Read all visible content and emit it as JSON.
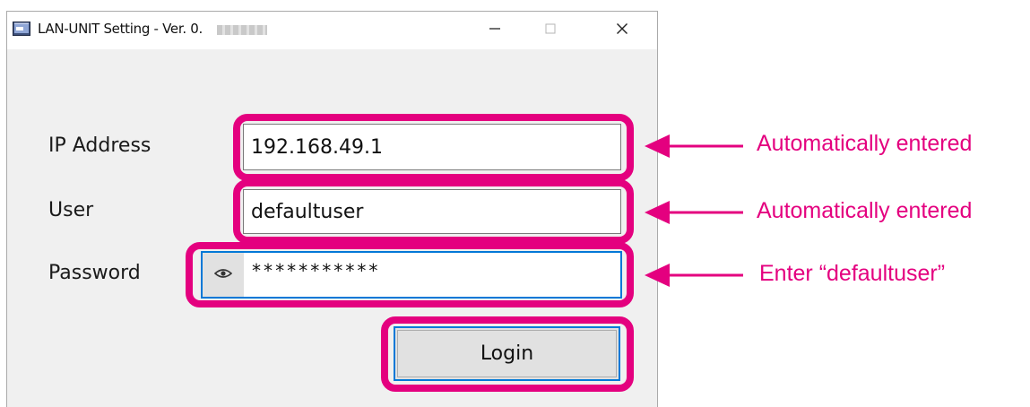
{
  "window": {
    "title": "LAN-UNIT Setting - Ver. 0.",
    "title_redacted": true
  },
  "form": {
    "ip_label": "IP Address",
    "ip_value": "192.168.49.1",
    "user_label": "User",
    "user_value": "defaultuser",
    "password_label": "Password",
    "password_value": "***********",
    "login_label": "Login"
  },
  "annotations": {
    "ip_note": "Automatically entered",
    "user_note": "Automatically entered",
    "password_note": "Enter “defaultuser”"
  },
  "colors": {
    "highlight": "#e4007f",
    "focus": "#0078d7"
  },
  "icons": {
    "app": "app-window-icon",
    "minimize": "minimize-icon",
    "maximize": "maximize-icon",
    "close": "close-icon",
    "show_password": "eye-icon"
  }
}
